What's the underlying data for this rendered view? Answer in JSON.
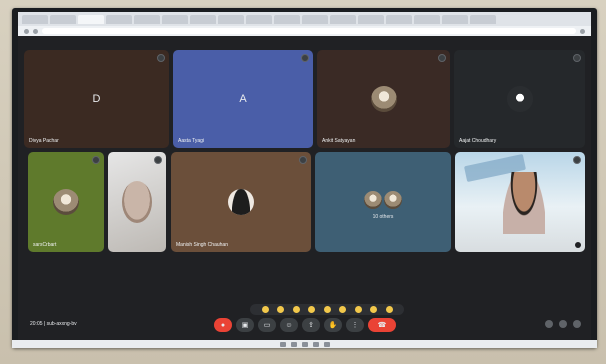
{
  "participants": [
    {
      "name": "Divya Pachar",
      "initial": "D"
    },
    {
      "name": "Aasta Tyagi",
      "initial": "A"
    },
    {
      "name": "Ankit Satyayan"
    },
    {
      "name": "Aajat Choudhary"
    },
    {
      "name": "sarsCrbart"
    },
    {
      "name": ""
    },
    {
      "name": "Manish Singh Chauhan"
    },
    {
      "name": "",
      "others_label": "10 others"
    },
    {
      "name": ""
    }
  ],
  "meeting": {
    "time": "20:05",
    "separator": "|",
    "code": "sub-axxng-bv"
  },
  "colors": {
    "tile_d": "#3b2a22",
    "tile_a": "#4a5ea8",
    "tile_ankit": "#3a2a25",
    "tile_aajat": "#25282b",
    "tile_green": "#5f7a2c",
    "tile_manish": "#6b4f3a",
    "tile_others": "#3e5f74",
    "leave_red": "#ea4335"
  },
  "icons": [
    "mic-icon",
    "camera-icon",
    "captions-icon",
    "hand-icon",
    "present-icon",
    "more-icon",
    "leave-call-icon",
    "info-icon",
    "chat-icon",
    "people-icon"
  ]
}
